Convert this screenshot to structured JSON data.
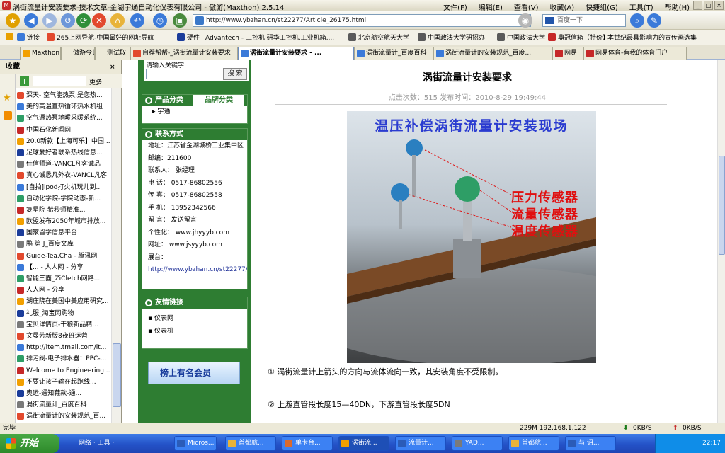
{
  "window": {
    "title": "涡街流量计安装要求-技术文章-金湖宇通自动化仪表有限公司 - 傲游(Maxthon) 2.5.14"
  },
  "menu": [
    "文件(F)",
    "编辑(E)",
    "查看(V)",
    "收藏(A)",
    "快捷组(G)",
    "工具(T)",
    "帮助(H)"
  ],
  "address": {
    "url": "http://www.ybzhan.cn/st22277/Article_26175.html",
    "search_placeholder": "百度一下"
  },
  "favorites": [
    "链接",
    "265上网导航-中国最好的网址导航",
    "硬件",
    "Advantech - 工控机,研华工控机,工业机箱,...",
    "北京航空航天大学",
    "中国政法大学研招办",
    "中国政法大学",
    "鼎冠信箱【特价】",
    "本世纪最具影响力的宣传画选集"
  ],
  "tabs": [
    "Maxthon",
    "傲游今日",
    "测试取",
    "自荐帮帮-_涡街流量计安装要求",
    "涡街流量计安装要求 - ...",
    "涡街流量计_百度百科",
    "涡街流量计的安装规范_百度...",
    "网易",
    "网易体育-有我的体育门户"
  ],
  "sidebar": {
    "title": "收藏",
    "more": "更多",
    "items": [
      "深天- 空气能热泵,是您热...",
      "美的高温直热循环热水机组",
      "空气源热泵地暖采暖系统...",
      "中国石化新闻网",
      "20.0新款【上海可乐】中国...",
      "足球爱好者联系热线信息...",
      "佳信师道-VANCL凡客诚品",
      "真心诚恳凡外衣-VANCL凡客",
      "[自拍]ipod打火机玩儿到...",
      "自动化学院-学院动态-新...",
      "复星院 希秒师精准...",
      "欧盟发布2050年城市排放...",
      "国家留学信息平台",
      "鹏 第 J_百度文库",
      "Guide-Tea.Cha - 腾讯网",
      "【...  - 人人网 - 分享",
      "智能三面_ZiCletch网路...",
      "人人网 - 分享",
      "湖庄院在美国中美应用研究...",
      "礼服_淘宝网购物",
      "宝贝详情页-干粮新品精...",
      "文曼芳新版8夜班运营",
      "http://item.tmall.com/it...",
      "排污阀-电子排水器：PPC-...",
      "Welcome to Engineering ...",
      "不要让孩子输在起跑线...",
      "奥运-通知鞋款-通...",
      "涡街流量计_百度百科",
      "涡街流量计的安装规范_百..."
    ]
  },
  "page": {
    "search_label": "请输入关键字",
    "search_button": "搜 索",
    "product_tab": "产品分类",
    "brand_tab": "品牌分类",
    "brand_item": "宇通",
    "contact": {
      "title": "联系方式",
      "address": "地址：江苏省金湖城桥工业集中区",
      "zip": "邮编：211600",
      "person": "联系人：  张经理",
      "tel": "电  话：  0517-86802556",
      "fax": "传  真：  0517-86802558",
      "mobile": "手  机：  13952342566",
      "email": "留  言：  发送留言",
      "site1": "个性化：  www.jhyyyb.com",
      "site2": "网址：  www.jsyyyb.com",
      "shop_label": "展台：",
      "shop_url": "http://www.ybzhan.cn/st22277/"
    },
    "links": {
      "title": "友情链接",
      "items": [
        "仪表网",
        "仪表机"
      ]
    },
    "badge": "榜上有名会员",
    "article": {
      "title": "涡街流量计安装要求",
      "meta": "点击次数：515  发布时间：2010-8-29 19:49:44",
      "photo_title": "温压补偿涡街流量计安装现场",
      "labels": [
        "压力传感器",
        "流量传感器",
        "温度传感器"
      ],
      "p1": "① 涡街流量计上箭头的方向与流体流向一致，其安装角度不受限制。",
      "p2": "② 上游直管段长度15—40DN，下游直管段长度5DN"
    }
  },
  "status": {
    "text": "完毕",
    "ip": "229M 192.168.1.122",
    "net_down": "0KB/S",
    "net_up": "0KB/S"
  },
  "taskbar": {
    "start": "开始",
    "items": [
      "网络 · 工具 ·",
      "Micros...",
      "首都航...",
      "单卡台...",
      "涡街流...",
      "流量计...",
      "YAD...",
      "首都航...",
      "与 诏..."
    ],
    "clock": "22:17"
  }
}
